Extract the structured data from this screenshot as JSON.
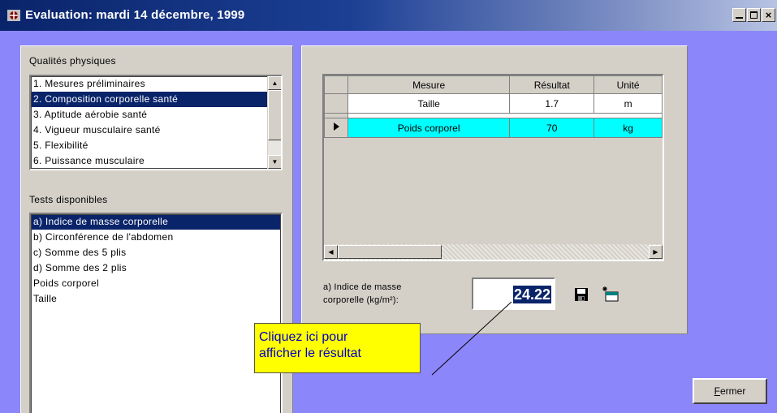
{
  "window": {
    "title": "Evaluation: mardi 14 décembre, 1999",
    "min_glyph": "_",
    "close_glyph": "×"
  },
  "qualites": {
    "label": "Qualités physiques",
    "items": [
      "1. Mesures préliminaires",
      "2. Composition corporelle santé",
      "3. Aptitude aérobie santé",
      "4. Vigueur musculaire santé",
      "5. Flexibilité",
      "6. Puissance musculaire"
    ],
    "selected_index": 1
  },
  "tests": {
    "label": "Tests disponibles",
    "items": [
      "a) Indice de masse corporelle",
      "b) Circonférence de l'abdomen",
      "c) Somme des 5 plis",
      "d) Somme des 2 plis",
      "Poids corporel",
      "Taille"
    ],
    "selected_index": 0
  },
  "grid": {
    "headers": [
      "Mesure",
      "Résultat",
      "Unité"
    ],
    "rows": [
      {
        "mesure": "Taille",
        "resultat": "1.7",
        "unite": "m"
      },
      {
        "mesure": "Poids corporel",
        "resultat": "70",
        "unite": "kg"
      }
    ],
    "current_row": 1,
    "highlight_color": "#00ffff"
  },
  "result": {
    "label_line1": "a) Indice de masse",
    "label_line2": "corporelle (kg/m²):",
    "value": "24.22"
  },
  "buttons": {
    "save_icon": "floppy-disk-icon",
    "new_icon": "new-document-icon",
    "fermer_mnemonic": "F",
    "fermer_rest": "ermer"
  },
  "callout": {
    "line1": "Cliquez ici pour",
    "line2": "afficher le résultat"
  },
  "colors": {
    "client_bg": "#8c86fb",
    "selection": "#0a246a",
    "callout_bg": "#ffff00",
    "callout_text": "#0000cc"
  }
}
